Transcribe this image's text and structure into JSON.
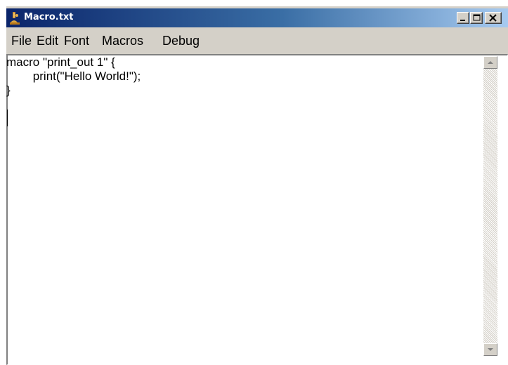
{
  "window": {
    "title": "Macro.txt",
    "icon": "app-flask-icon",
    "controls": {
      "minimize": "minimize-icon",
      "maximize": "maximize-icon",
      "close": "close-icon"
    }
  },
  "menu": {
    "items": [
      {
        "label": "File"
      },
      {
        "label": "Edit"
      },
      {
        "label": "Font"
      },
      {
        "label": "Macros"
      },
      {
        "label": "Debug"
      }
    ]
  },
  "editor": {
    "lines": [
      "macro \"print_out 1\" {",
      "\tprint(\"Hello World!\");",
      "}"
    ]
  },
  "scrollbar": {
    "up_icon": "scroll-up-arrow-icon",
    "down_icon": "scroll-down-arrow-icon"
  },
  "colors": {
    "titlebar_start": "#0a246a",
    "titlebar_end": "#a6caf0",
    "chrome": "#d4d0c8"
  }
}
